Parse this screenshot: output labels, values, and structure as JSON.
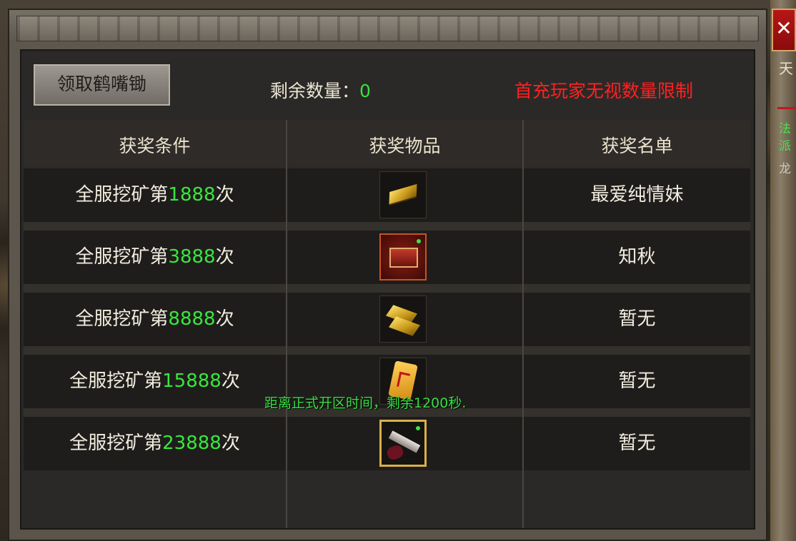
{
  "window": {
    "close_glyph": "✕"
  },
  "side": {
    "t1": "天",
    "t2": "法",
    "t3": "派",
    "t4": "龙"
  },
  "header": {
    "claim_button": "领取鹤嘴锄",
    "remain_label": "剩余数量：",
    "remain_value": "0",
    "notice": "首充玩家无视数量限制"
  },
  "table": {
    "columns": [
      "获奖条件",
      "获奖物品",
      "获奖名单"
    ],
    "cond_prefix": "全服挖矿第",
    "cond_suffix": "次",
    "rows": [
      {
        "count": "1888",
        "item_icon": "gold-bar-icon",
        "winner": "最爱纯情妹"
      },
      {
        "count": "3888",
        "item_icon": "treasure-chest-icon",
        "winner": "知秋"
      },
      {
        "count": "8888",
        "item_icon": "gold-stack-icon",
        "winner": "暂无"
      },
      {
        "count": "15888",
        "item_icon": "gold-scroll-icon",
        "winner": "暂无"
      },
      {
        "count": "23888",
        "item_icon": "relic-scroll-icon",
        "winner": "暂无"
      }
    ]
  },
  "system_message": "距离正式开区时间，剩余1200秒.",
  "colors": {
    "accent_green": "#36e043",
    "notice_red": "#ff2121"
  }
}
